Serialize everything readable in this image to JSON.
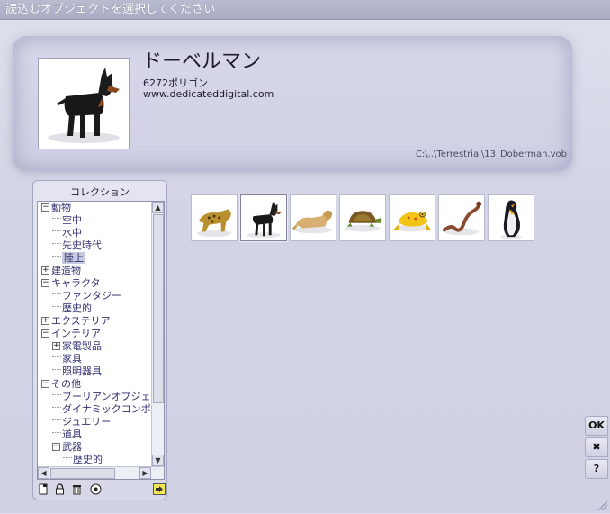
{
  "window": {
    "title": "読込むオブジェクトを選択してください"
  },
  "selected_object": {
    "name": "ドーベルマン",
    "polygons": "6272ポリゴン",
    "url": "www.dedicateddigital.com",
    "path": "C:\\..\\Terrestrial\\13_Doberman.vob",
    "icon": "doberman-thumbnail"
  },
  "collection": {
    "title": "コレクション",
    "tree": [
      {
        "label": "動物",
        "level": 0,
        "toggle": "−"
      },
      {
        "label": "空中",
        "level": 1
      },
      {
        "label": "水中",
        "level": 1
      },
      {
        "label": "先史時代",
        "level": 1
      },
      {
        "label": "陸上",
        "level": 1,
        "selected": true
      },
      {
        "label": "建造物",
        "level": 0,
        "toggle": "+"
      },
      {
        "label": "キャラクタ",
        "level": 0,
        "toggle": "−"
      },
      {
        "label": "ファンタジー",
        "level": 1
      },
      {
        "label": "歴史的",
        "level": 1
      },
      {
        "label": "エクステリア",
        "level": 0,
        "toggle": "+"
      },
      {
        "label": "インテリア",
        "level": 0,
        "toggle": "−"
      },
      {
        "label": "家電製品",
        "level": 1,
        "toggle": "+"
      },
      {
        "label": "家具",
        "level": 1
      },
      {
        "label": "照明器具",
        "level": 1
      },
      {
        "label": "その他",
        "level": 0,
        "toggle": "−"
      },
      {
        "label": "ブーリアンオブジェ",
        "level": 1
      },
      {
        "label": "ダイナミックコンポ",
        "level": 1
      },
      {
        "label": "ジュエリー",
        "level": 1
      },
      {
        "label": "道具",
        "level": 1
      },
      {
        "label": "武器",
        "level": 1,
        "toggle": "−"
      },
      {
        "label": "歴史的",
        "level": 2
      }
    ],
    "toolbar": [
      "new-collection-icon",
      "lock-icon",
      "trash-icon",
      "add-object-icon",
      "arrow-right-icon"
    ]
  },
  "library": [
    {
      "name": "leopard",
      "icon": "leopard-thumbnail"
    },
    {
      "name": "doberman",
      "icon": "doberman-thumbnail",
      "selected": true
    },
    {
      "name": "lion",
      "icon": "lion-thumbnail"
    },
    {
      "name": "turtle",
      "icon": "turtle-thumbnail"
    },
    {
      "name": "frog",
      "icon": "frog-thumbnail"
    },
    {
      "name": "snake",
      "icon": "snake-thumbnail"
    },
    {
      "name": "penguin",
      "icon": "penguin-thumbnail"
    }
  ],
  "side_buttons": {
    "ok": "OK",
    "cancel": "✖",
    "help": "?"
  }
}
